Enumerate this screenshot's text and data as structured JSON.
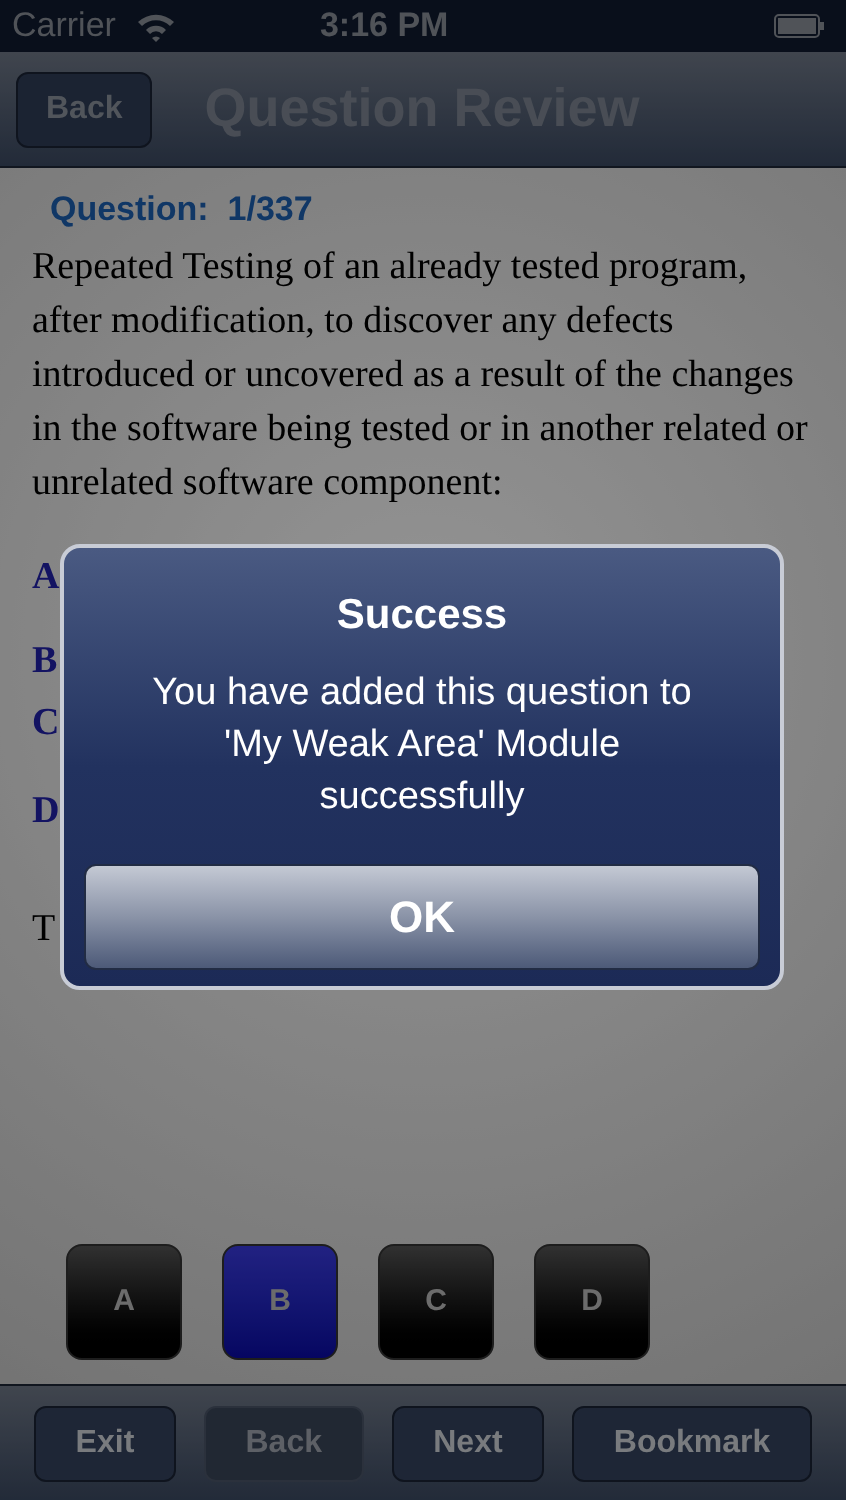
{
  "status_bar": {
    "carrier": "Carrier",
    "time": "3:16 PM"
  },
  "nav": {
    "back": "Back",
    "title": "Question Review"
  },
  "question": {
    "label": "Question:  1/337",
    "text": "Repeated Testing of an already tested program, after modification, to discover any defects introduced or uncovered as a result of the changes in the software being tested or in another related or unrelated software component:"
  },
  "options": [
    {
      "letter": "A"
    },
    {
      "letter": "B"
    },
    {
      "letter": "C"
    },
    {
      "letter": "D"
    }
  ],
  "tips": "T",
  "answers": [
    {
      "label": "A",
      "selected": false
    },
    {
      "label": "B",
      "selected": true
    },
    {
      "label": "C",
      "selected": false
    },
    {
      "label": "D",
      "selected": false
    }
  ],
  "toolbar": [
    {
      "label": "Exit",
      "disabled": false
    },
    {
      "label": "Back",
      "disabled": true
    },
    {
      "label": "Next",
      "disabled": false
    },
    {
      "label": "Bookmark",
      "disabled": false
    }
  ],
  "alert": {
    "title": "Success",
    "message": "You have added this question to 'My Weak Area' Module successfully",
    "button": "OK"
  }
}
